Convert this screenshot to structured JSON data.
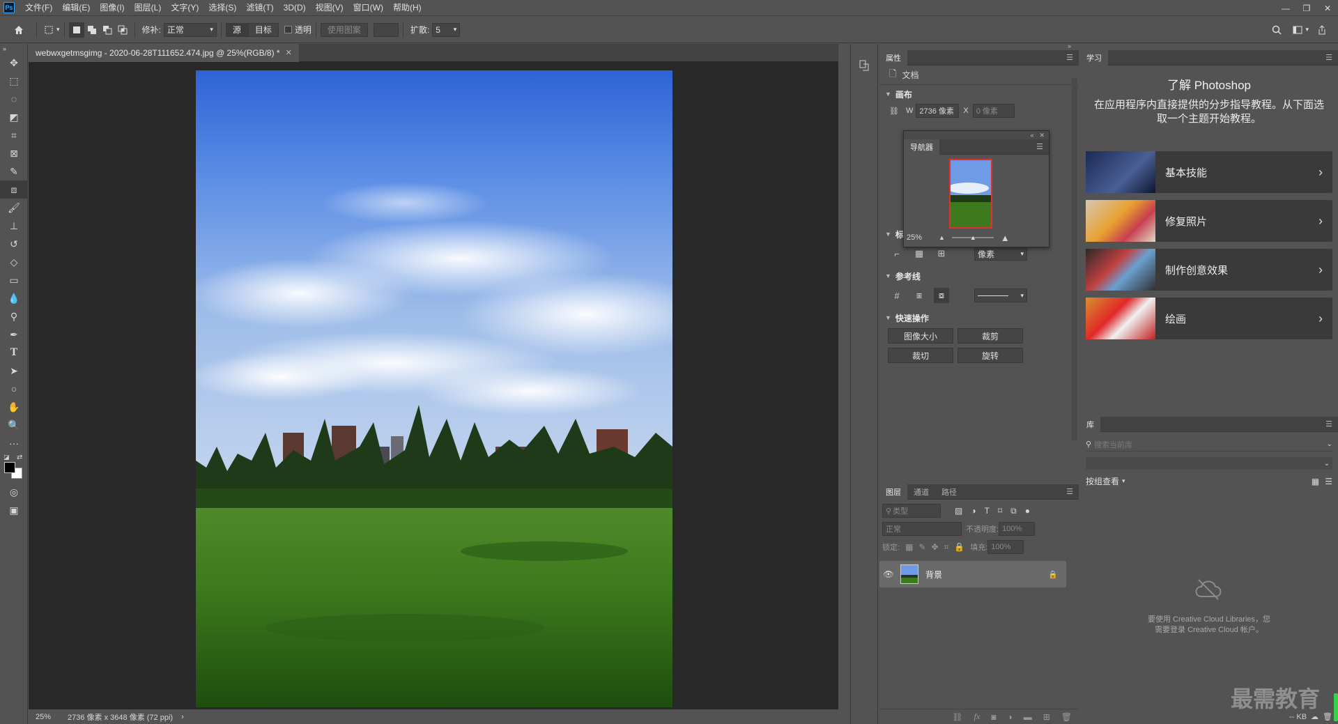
{
  "app": {
    "logo": "Ps",
    "menu": [
      "文件(F)",
      "编辑(E)",
      "图像(I)",
      "图层(L)",
      "文字(Y)",
      "选择(S)",
      "滤镜(T)",
      "3D(D)",
      "视图(V)",
      "窗口(W)",
      "帮助(H)"
    ]
  },
  "options": {
    "repair_label": "修补:",
    "repair_mode": "正常",
    "source_label": "源",
    "target_label": "目标",
    "transparent_label": "透明",
    "use_pattern_label": "使用图案",
    "diffusion_label": "扩散:",
    "diffusion_value": "5"
  },
  "document": {
    "tab_title": "webwxgetmsgimg - 2020-06-28T111652.474.jpg @ 25%(RGB/8) *",
    "zoom": "25%",
    "doc_info": "2736 像素 x 3648 像素 (72 ppi)"
  },
  "properties": {
    "tab": "属性",
    "doc_label": "文档",
    "canvas_section": "画布",
    "w_label": "W",
    "w_value": "2736 像素",
    "x_label": "X",
    "x_value": "0 像素",
    "rulers_section": "标尺和网格",
    "unit_value": "像素",
    "guides_section": "参考线",
    "quick_section": "快速操作",
    "btn_image_size": "图像大小",
    "btn_crop": "裁剪",
    "btn_trim": "裁切",
    "btn_rotate": "旋转"
  },
  "navigator": {
    "tab": "导航器",
    "zoom": "25%"
  },
  "layers": {
    "tabs": [
      "图层",
      "通道",
      "路径"
    ],
    "filter_placeholder": "类型",
    "blend_mode": "正常",
    "opacity_label": "不透明度:",
    "opacity_value": "100%",
    "lock_label": "锁定:",
    "fill_label": "填充:",
    "fill_value": "100%",
    "layer_name": "背景"
  },
  "learn": {
    "tab": "学习",
    "title": "了解 Photoshop",
    "description": "在应用程序内直接提供的分步指导教程。从下面选取一个主题开始教程。",
    "cards": [
      {
        "label": "基本技能"
      },
      {
        "label": "修复照片"
      },
      {
        "label": "制作创意效果"
      },
      {
        "label": "绘画"
      }
    ]
  },
  "libraries": {
    "tab": "库",
    "search_placeholder": "搜索当前库",
    "group_view": "按组查看",
    "signin_message_1": "要使用 Creative Cloud Libraries，您",
    "signin_message_2": "需要登录 Creative Cloud 帐户。",
    "kb_label": "-- KB"
  },
  "watermark": "最需教育",
  "colors": {
    "panel_bg": "#535353",
    "canvas_bg": "#282828",
    "accent_red": "#e03030",
    "foreground": "#000000",
    "background": "#ffffff"
  }
}
